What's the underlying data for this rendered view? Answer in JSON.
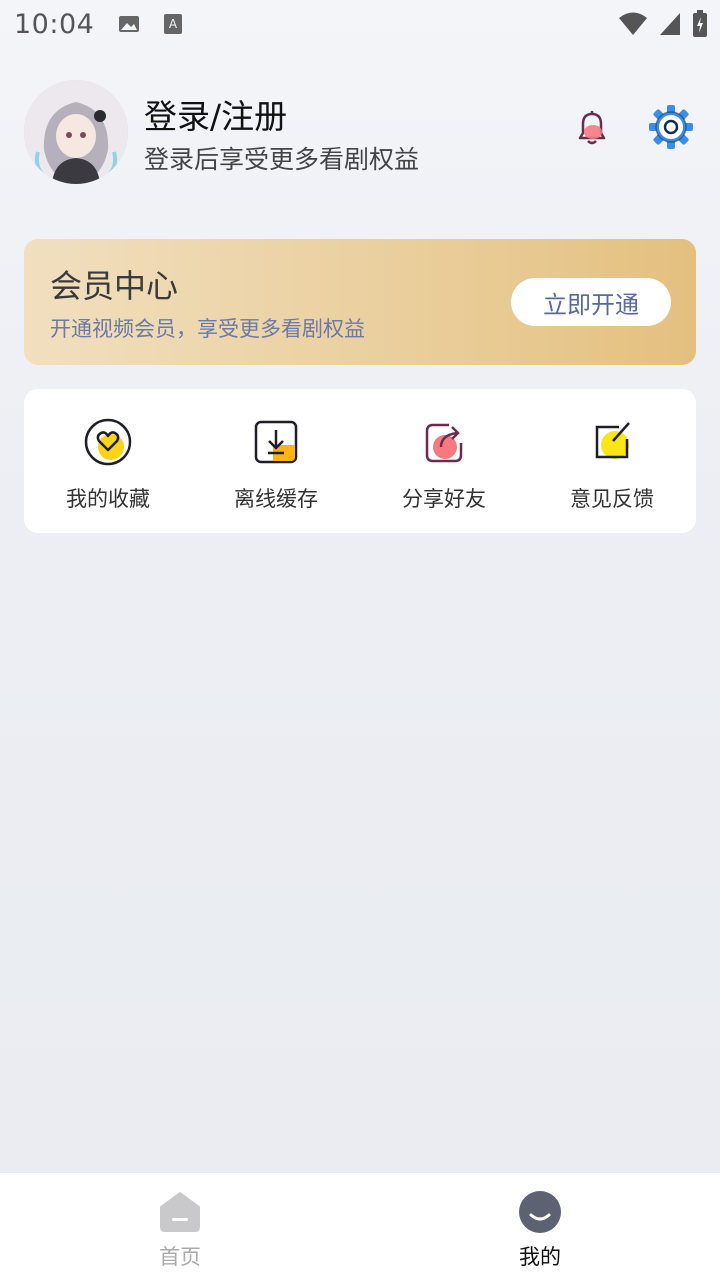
{
  "status_bar": {
    "time": "10:04",
    "icons": [
      "image-icon",
      "a-text-icon",
      "wifi-icon",
      "signal-icon",
      "battery-icon"
    ]
  },
  "profile": {
    "title": "登录/注册",
    "subtitle": "登录后享受更多看剧权益",
    "icons": [
      "avatar",
      "bell-icon",
      "gear-icon"
    ]
  },
  "vip": {
    "title": "会员中心",
    "subtitle": "开通视频会员，享受更多看剧权益",
    "button_label": "立即开通",
    "colors": {
      "gradient_start": "#f1dfbf",
      "gradient_end": "#e4c07f",
      "accent": "#5a6aa0"
    }
  },
  "actions": [
    {
      "label": "我的收藏",
      "icon": "heart-circle-icon"
    },
    {
      "label": "离线缓存",
      "icon": "download-icon"
    },
    {
      "label": "分享好友",
      "icon": "share-icon"
    },
    {
      "label": "意见反馈",
      "icon": "feedback-icon"
    }
  ],
  "bottom_nav": {
    "items": [
      {
        "label": "首页",
        "icon": "home-icon",
        "active": false
      },
      {
        "label": "我的",
        "icon": "profile-icon",
        "active": true
      }
    ]
  }
}
